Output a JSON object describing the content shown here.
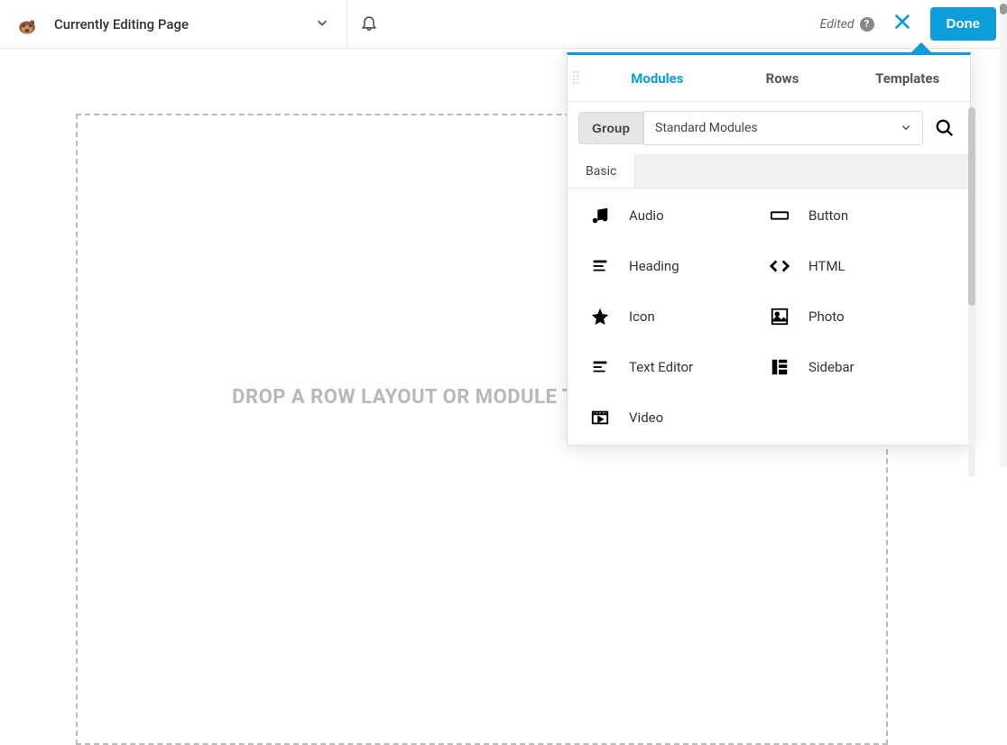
{
  "topbar": {
    "page_title": "Currently Editing Page",
    "status": "Edited",
    "done_label": "Done"
  },
  "panel": {
    "tabs": [
      "Modules",
      "Rows",
      "Templates"
    ],
    "active_tab_index": 0,
    "group_label": "Group",
    "select_value": "Standard Modules",
    "section_tabs": [
      "Basic"
    ],
    "active_section_index": 0,
    "modules": [
      {
        "icon": "audio",
        "label": "Audio"
      },
      {
        "icon": "button",
        "label": "Button"
      },
      {
        "icon": "heading",
        "label": "Heading"
      },
      {
        "icon": "html",
        "label": "HTML"
      },
      {
        "icon": "icon",
        "label": "Icon"
      },
      {
        "icon": "photo",
        "label": "Photo"
      },
      {
        "icon": "text-editor",
        "label": "Text Editor"
      },
      {
        "icon": "sidebar",
        "label": "Sidebar"
      },
      {
        "icon": "video",
        "label": "Video"
      }
    ]
  },
  "canvas": {
    "dropzone_text": "DROP A ROW LAYOUT OR MODULE TO GET STARTED!"
  }
}
